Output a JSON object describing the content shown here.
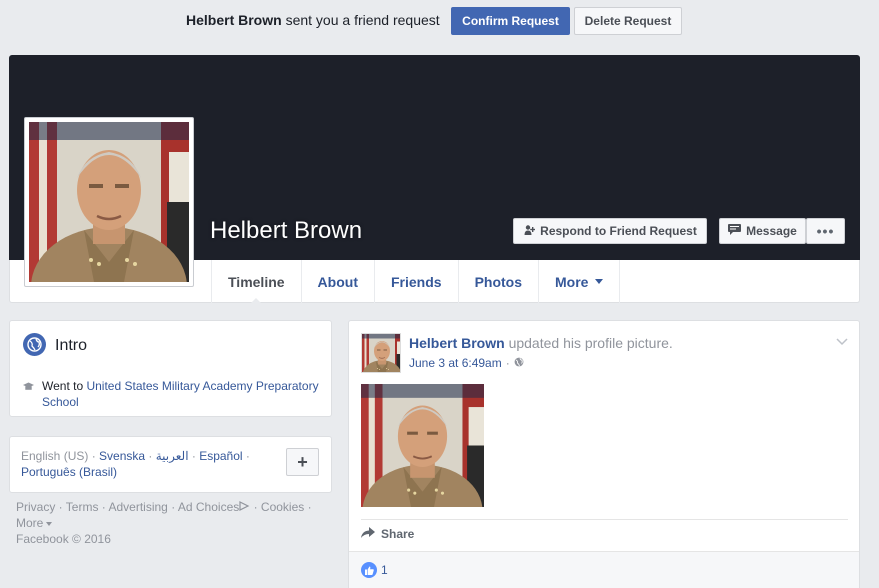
{
  "friend_request": {
    "name": "Helbert Brown",
    "suffix": " sent you a friend request",
    "confirm_label": "Confirm Request",
    "delete_label": "Delete Request"
  },
  "profile": {
    "name": "Helbert Brown",
    "respond_label": "Respond to Friend Request",
    "message_label": "Message",
    "more_dots": "•••"
  },
  "tabs": [
    {
      "label": "Timeline"
    },
    {
      "label": "About"
    },
    {
      "label": "Friends"
    },
    {
      "label": "Photos"
    },
    {
      "label": "More"
    }
  ],
  "intro": {
    "title": "Intro",
    "went_prefix": "Went to ",
    "school": "United States Military Academy Preparatory School"
  },
  "languages": {
    "current": "English (US)",
    "sep": " · ",
    "items": [
      "Svenska",
      "العربية",
      "Español",
      "Português (Brasil)"
    ],
    "add_label": "+"
  },
  "footer": {
    "links": [
      "Privacy",
      "Terms",
      "Advertising",
      "Ad Choices",
      "Cookies",
      "More"
    ],
    "copyright": "Facebook © 2016"
  },
  "post": {
    "author": "Helbert Brown",
    "action": " updated his profile picture.",
    "date": "June 3 at 6:49am",
    "meta_sep": " ·",
    "share_label": "Share",
    "like_count": "1"
  },
  "colors": {
    "brand": "#4267b2",
    "link": "#365899",
    "cover": "#1d2029",
    "background": "#e9ebee"
  },
  "icons": [
    "add-friend-icon",
    "message-icon",
    "globe-icon",
    "graduation-cap-icon",
    "ad-choices-icon",
    "public-globe-icon",
    "chevron-down-icon",
    "share-arrow-icon",
    "like-thumb-icon"
  ]
}
